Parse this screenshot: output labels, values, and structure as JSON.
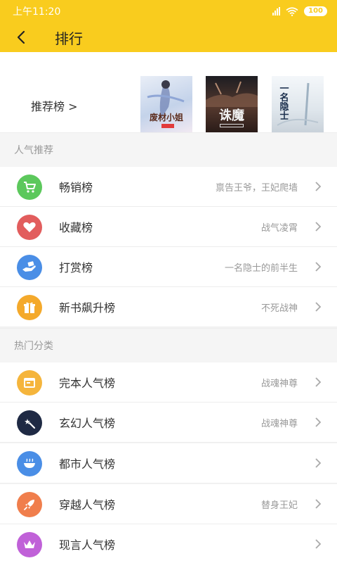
{
  "status": {
    "time": "上午11:20",
    "battery": "100"
  },
  "header": {
    "title": "排行"
  },
  "recommend": {
    "label": "推荐榜 >",
    "covers": [
      {
        "title": "废材小姐"
      },
      {
        "title": "诛魔"
      },
      {
        "title": "一名隐士"
      }
    ]
  },
  "popular": {
    "title": "人气推荐",
    "items": [
      {
        "name": "畅销榜",
        "hint": "禀告王爷，王妃爬墙",
        "icon": "cart-icon",
        "color": "#5cc85c"
      },
      {
        "name": "收藏榜",
        "hint": "战气凌霄",
        "icon": "heart-icon",
        "color": "#e25d5d"
      },
      {
        "name": "打赏榜",
        "hint": "一名隐士的前半生",
        "icon": "reward-hand-icon",
        "color": "#4a8ee6"
      },
      {
        "name": "新书飙升榜",
        "hint": "不死战神",
        "icon": "gift-icon",
        "color": "#f4a92b"
      }
    ]
  },
  "categories": {
    "title": "热门分类",
    "items": [
      {
        "name": "完本人气榜",
        "hint": "战魂神尊",
        "icon": "window-icon",
        "color": "#f5b53c"
      },
      {
        "name": "玄幻人气榜",
        "hint": "战魂神尊",
        "icon": "magic-wand-icon",
        "color": "#1f2a44"
      },
      {
        "name": "都市人气榜",
        "hint": "",
        "icon": "bowl-icon",
        "color": "#4a8ee6"
      },
      {
        "name": "穿越人气榜",
        "hint": "替身王妃",
        "icon": "rocket-icon",
        "color": "#f07e4c"
      },
      {
        "name": "现言人气榜",
        "hint": "",
        "icon": "crown-icon",
        "color": "#c061d8"
      }
    ]
  }
}
